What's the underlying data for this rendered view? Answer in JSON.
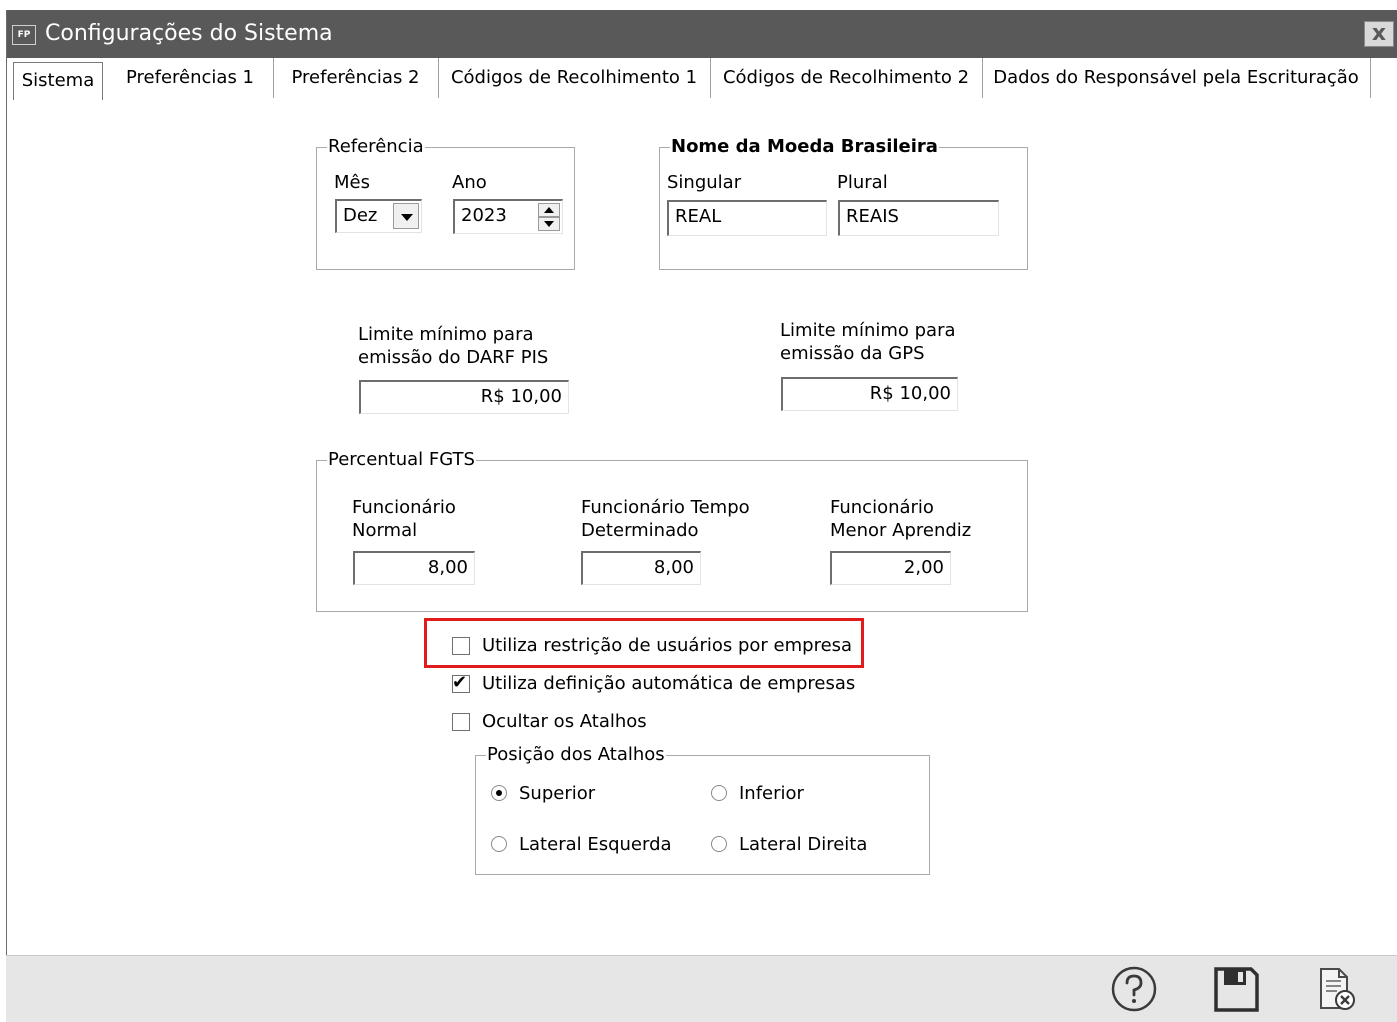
{
  "window": {
    "app_icon_text": "FP",
    "title": "Configurações do Sistema",
    "close_label": "x"
  },
  "tabs": [
    {
      "label": "Sistema",
      "underline": "S",
      "rest": "istema",
      "active": true
    },
    {
      "label": "Preferências 1",
      "underline": "P",
      "rest": "referências 1"
    },
    {
      "label": "Preferências 2"
    },
    {
      "label": "Códigos de Recolhimento 1"
    },
    {
      "label": "Códigos de Recolhimento 2"
    },
    {
      "label": "Dados do Responsável pela Escrituração"
    }
  ],
  "referencia": {
    "legend": "Referência",
    "mes_label": "Mês",
    "mes_value": "Dez",
    "ano_label": "Ano",
    "ano_value": "2023"
  },
  "moeda": {
    "legend": "Nome da Moeda Brasileira",
    "singular_label": "Singular",
    "singular_value": "REAL",
    "plural_label": "Plural",
    "plural_value": "REAIS"
  },
  "limites": {
    "darf_label_1": "Limite mínimo para",
    "darf_label_2": "emissão do DARF PIS",
    "darf_value": "R$ 10,00",
    "gps_label_1": "Limite mínimo para",
    "gps_label_2": "emissão da GPS",
    "gps_value": "R$ 10,00"
  },
  "fgts": {
    "legend": "Percentual FGTS",
    "normal_label_1": "Funcionário",
    "normal_label_2": "Normal",
    "normal_value": "8,00",
    "tempo_label_1": "Funcionário Tempo",
    "tempo_label_2": "Determinado",
    "tempo_value": "8,00",
    "aprendiz_label_1": "Funcionário",
    "aprendiz_label_2": "Menor Aprendiz",
    "aprendiz_value": "2,00"
  },
  "options": {
    "restricao_label": "Utiliza restrição de usuários por empresa",
    "restricao_checked": false,
    "definicao_label": "Utiliza definição automática de empresas",
    "definicao_checked": true,
    "ocultar_label": "Ocultar os Atalhos",
    "ocultar_checked": false
  },
  "posicao": {
    "legend": "Posição dos Atalhos",
    "superior": "Superior",
    "inferior": "Inferior",
    "lateral_esquerda": "Lateral Esquerda",
    "lateral_direita": "Lateral Direita",
    "selected": "Superior"
  },
  "check_glyph": "✔",
  "colors": {
    "titlebar": "#595959",
    "highlight": "#e01b1b",
    "bottombar": "#e6e6e6"
  },
  "icons": {
    "help": "help-icon",
    "save": "save-icon",
    "cancel": "cancel-icon"
  }
}
